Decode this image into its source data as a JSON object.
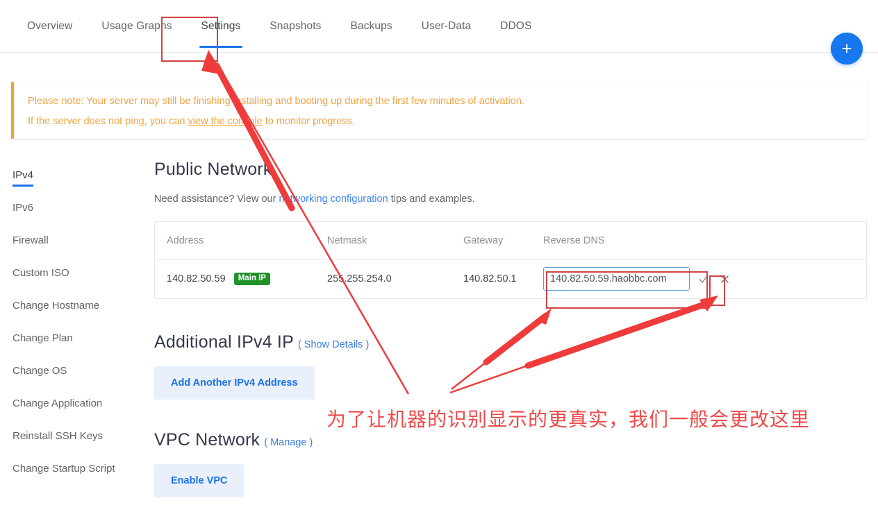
{
  "tabs": [
    {
      "label": "Overview",
      "active": false
    },
    {
      "label": "Usage Graphs",
      "active": false
    },
    {
      "label": "Settings",
      "active": true
    },
    {
      "label": "Snapshots",
      "active": false
    },
    {
      "label": "Backups",
      "active": false
    },
    {
      "label": "User-Data",
      "active": false
    },
    {
      "label": "DDOS",
      "active": false
    }
  ],
  "fab": {
    "label": "+",
    "color": "#1677ef"
  },
  "banner": {
    "line1": "Please note: Your server may still be finishing installing and booting up during the first few minutes of activation.",
    "line2_before": "If the server does not ping, you can ",
    "line2_link": "view the console",
    "line2_after": " to monitor progress.",
    "accent": "#f0a429"
  },
  "subnav": [
    {
      "label": "IPv4",
      "active": true
    },
    {
      "label": "IPv6",
      "active": false
    },
    {
      "label": "Firewall",
      "active": false
    },
    {
      "label": "Custom ISO",
      "active": false
    },
    {
      "label": "Change Hostname",
      "active": false
    },
    {
      "label": "Change Plan",
      "active": false
    },
    {
      "label": "Change OS",
      "active": false
    },
    {
      "label": "Change Application",
      "active": false
    },
    {
      "label": "Reinstall SSH Keys",
      "active": false
    },
    {
      "label": "Change Startup Script",
      "active": false
    }
  ],
  "public_network": {
    "title": "Public Network",
    "assist_before": "Need assistance? View our ",
    "assist_link": "networking configuration",
    "assist_after": " tips and examples.",
    "table": {
      "headers": [
        "Address",
        "Netmask",
        "Gateway",
        "Reverse DNS"
      ],
      "rows": [
        {
          "address": "140.82.50.59",
          "badge": "Main IP",
          "badge_color": "#21922b",
          "netmask": "255.255.254.0",
          "gateway": "140.82.50.1",
          "reverse_dns_value": "140.82.50.59.haobbc.com",
          "reverse_dns_placeholder": "Reverse DNS",
          "confirm_icon": "check-icon",
          "cancel_icon": "close-icon"
        }
      ]
    }
  },
  "additional_ipv4": {
    "title": "Additional IPv4 IP",
    "sub_link": "( Show Details )",
    "button": "Add Another IPv4 Address"
  },
  "vpc": {
    "title": "VPC Network",
    "sub_link": "( Manage )",
    "button": "Enable VPC"
  },
  "annotations": {
    "note_text": "为了让机器的识别显示的更真实，我们一般会更改这里",
    "note_color": "#ef4a4a",
    "highlight_color": "#d14343",
    "arrow_color": "#ef3b3b"
  }
}
